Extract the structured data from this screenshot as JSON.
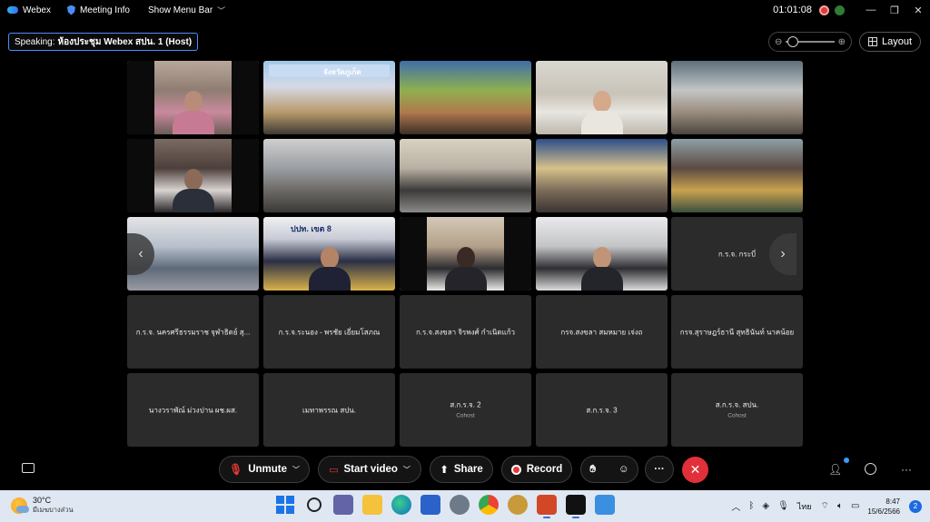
{
  "titlebar": {
    "app_name": "Webex",
    "meeting_info": "Meeting Info",
    "show_menu_bar": "Show Menu Bar",
    "timer": "01:01:08",
    "minimize": "—",
    "restore": "❐",
    "close": "✕"
  },
  "topbar": {
    "speaking_prefix": "Speaking:",
    "speaking_name": "ห้องประชุม Webex สปน. 1 (Host)",
    "layout_label": "Layout"
  },
  "tiles": {
    "t14": {
      "name": "ก.ร.จ. กระบี่"
    },
    "t15": {
      "name": "ก.ร.จ. นครศรีธรรมราช จุฬาธิดย์ สุ..."
    },
    "t16": {
      "name": "ก.ร.จ.ระนอง - พรชัย เอี่ยมโสภณ"
    },
    "t17": {
      "name": "ก.ร.จ.สงขลา จิรพงศ์ กำเนิดแก้ว"
    },
    "t18": {
      "name": "กรจ.สงขลา สมหมาย เจ่งถ"
    },
    "t19": {
      "name": "กรจ.สุราษฎร์ธานี สุทธินันท์ นาคน้อย"
    },
    "t20": {
      "name": "นางวราพัณ์ ม่วงปาน ผช.ผส."
    },
    "t21": {
      "name": "เมทาพรรณ สปน."
    },
    "t22": {
      "name": "ส.ก.ร.จ. 2",
      "role": "Cohost"
    },
    "t23": {
      "name": "ส.ก.ร.จ. 3"
    },
    "t24": {
      "name": "ส.ก.ร.จ. สปน.",
      "role": "Cohost"
    }
  },
  "video_banners": {
    "b2": "จังหวัดภูเก็ต",
    "b12": "ปปท. เขต 8"
  },
  "controls": {
    "unmute": "Unmute",
    "start_video": "Start video",
    "share": "Share",
    "record": "Record",
    "more": "···",
    "leave": "✕"
  },
  "taskbar": {
    "temperature": "30°C",
    "weather_desc": "มีเมฆบางส่วน",
    "lang": "ไทย",
    "time": "8:47",
    "date": "15/6/2566",
    "notifications": "2"
  },
  "colors": {
    "accent": "#4a8cff",
    "leave_red": "#e1303a",
    "tile_bg": "#2b2b2b"
  }
}
